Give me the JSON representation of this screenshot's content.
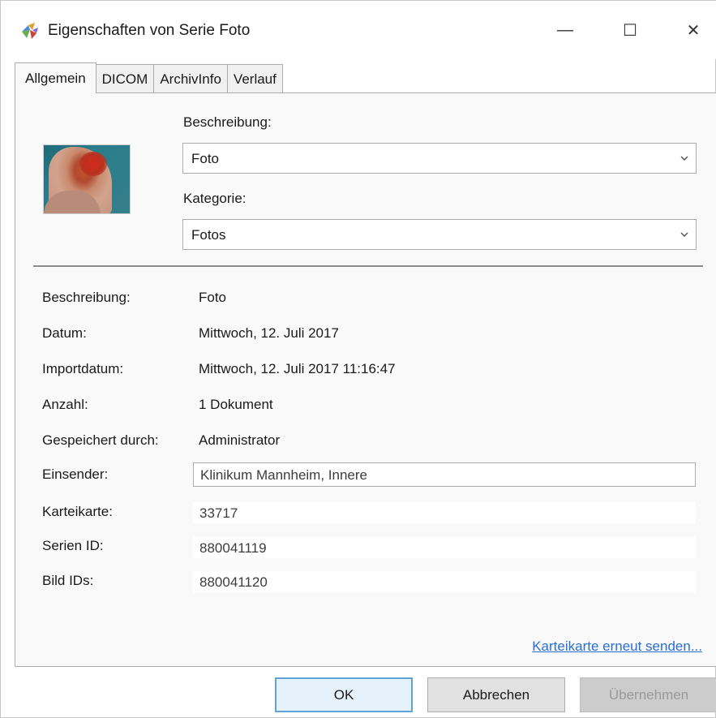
{
  "window": {
    "title": "Eigenschaften von Serie Foto",
    "controls": {
      "minimize": "—",
      "maximize": "☐",
      "close": "✕"
    }
  },
  "tabs": [
    {
      "label": "Allgemein",
      "active": true
    },
    {
      "label": "DICOM",
      "active": false
    },
    {
      "label": "ArchivInfo",
      "active": false
    },
    {
      "label": "Verlauf",
      "active": false
    }
  ],
  "general": {
    "description_label": "Beschreibung:",
    "description_value": "Foto",
    "category_label": "Kategorie:",
    "category_value": "Fotos",
    "thumbnail_icon": "photo-thumbnail-icon"
  },
  "details": [
    {
      "label": "Beschreibung:",
      "value": "Foto"
    },
    {
      "label": "Datum:",
      "value": "Mittwoch, 12. Juli 2017"
    },
    {
      "label": "Importdatum:",
      "value": "Mittwoch, 12. Juli 2017 11:16:47"
    },
    {
      "label": "Anzahl:",
      "value": "1 Dokument"
    },
    {
      "label": "Gespeichert durch:",
      "value": "Administrator"
    }
  ],
  "fields": {
    "einsender_label": "Einsender:",
    "einsender_value": "Klinikum Mannheim, Innere",
    "karteikarte_label": "Karteikarte:",
    "karteikarte_value": "33717",
    "serien_id_label": "Serien ID:",
    "serien_id_value": "880041119",
    "bild_ids_label": "Bild IDs:",
    "bild_ids_value": "880041120"
  },
  "link_resend": "Karteikarte erneut senden...",
  "buttons": {
    "ok": "OK",
    "cancel": "Abbrechen",
    "apply": "Übernehmen"
  },
  "colors": {
    "link": "#2a6fd0",
    "ok_border": "#5fa3d9",
    "panel_bg": "#f9f9f9"
  }
}
